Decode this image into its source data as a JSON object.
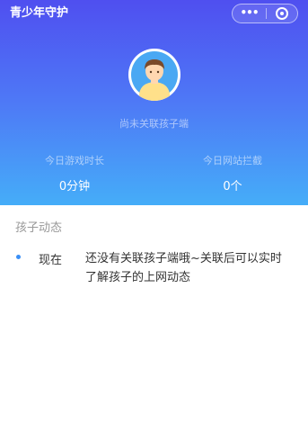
{
  "header": {
    "title": "青少年守护",
    "more_icon": "more-dots-icon",
    "close_icon": "target-close-icon",
    "more_glyph": "•••"
  },
  "profile": {
    "avatar_icon": "child-avatar-icon",
    "status": "尚未关联孩子端"
  },
  "stats": {
    "game_label": "今日游戏时长",
    "game_value": "0分钟",
    "block_label": "今日网站拦截",
    "block_value": "0个"
  },
  "activity": {
    "title": "孩子动态",
    "items": [
      {
        "time": "现在",
        "text": "还没有关联孩子端哦~关联后可以实时了解孩子的上网动态"
      }
    ]
  },
  "colors": {
    "gradient_top": "#4f4ff0",
    "gradient_bottom": "#45adf8",
    "bullet": "#3a8ff6"
  }
}
